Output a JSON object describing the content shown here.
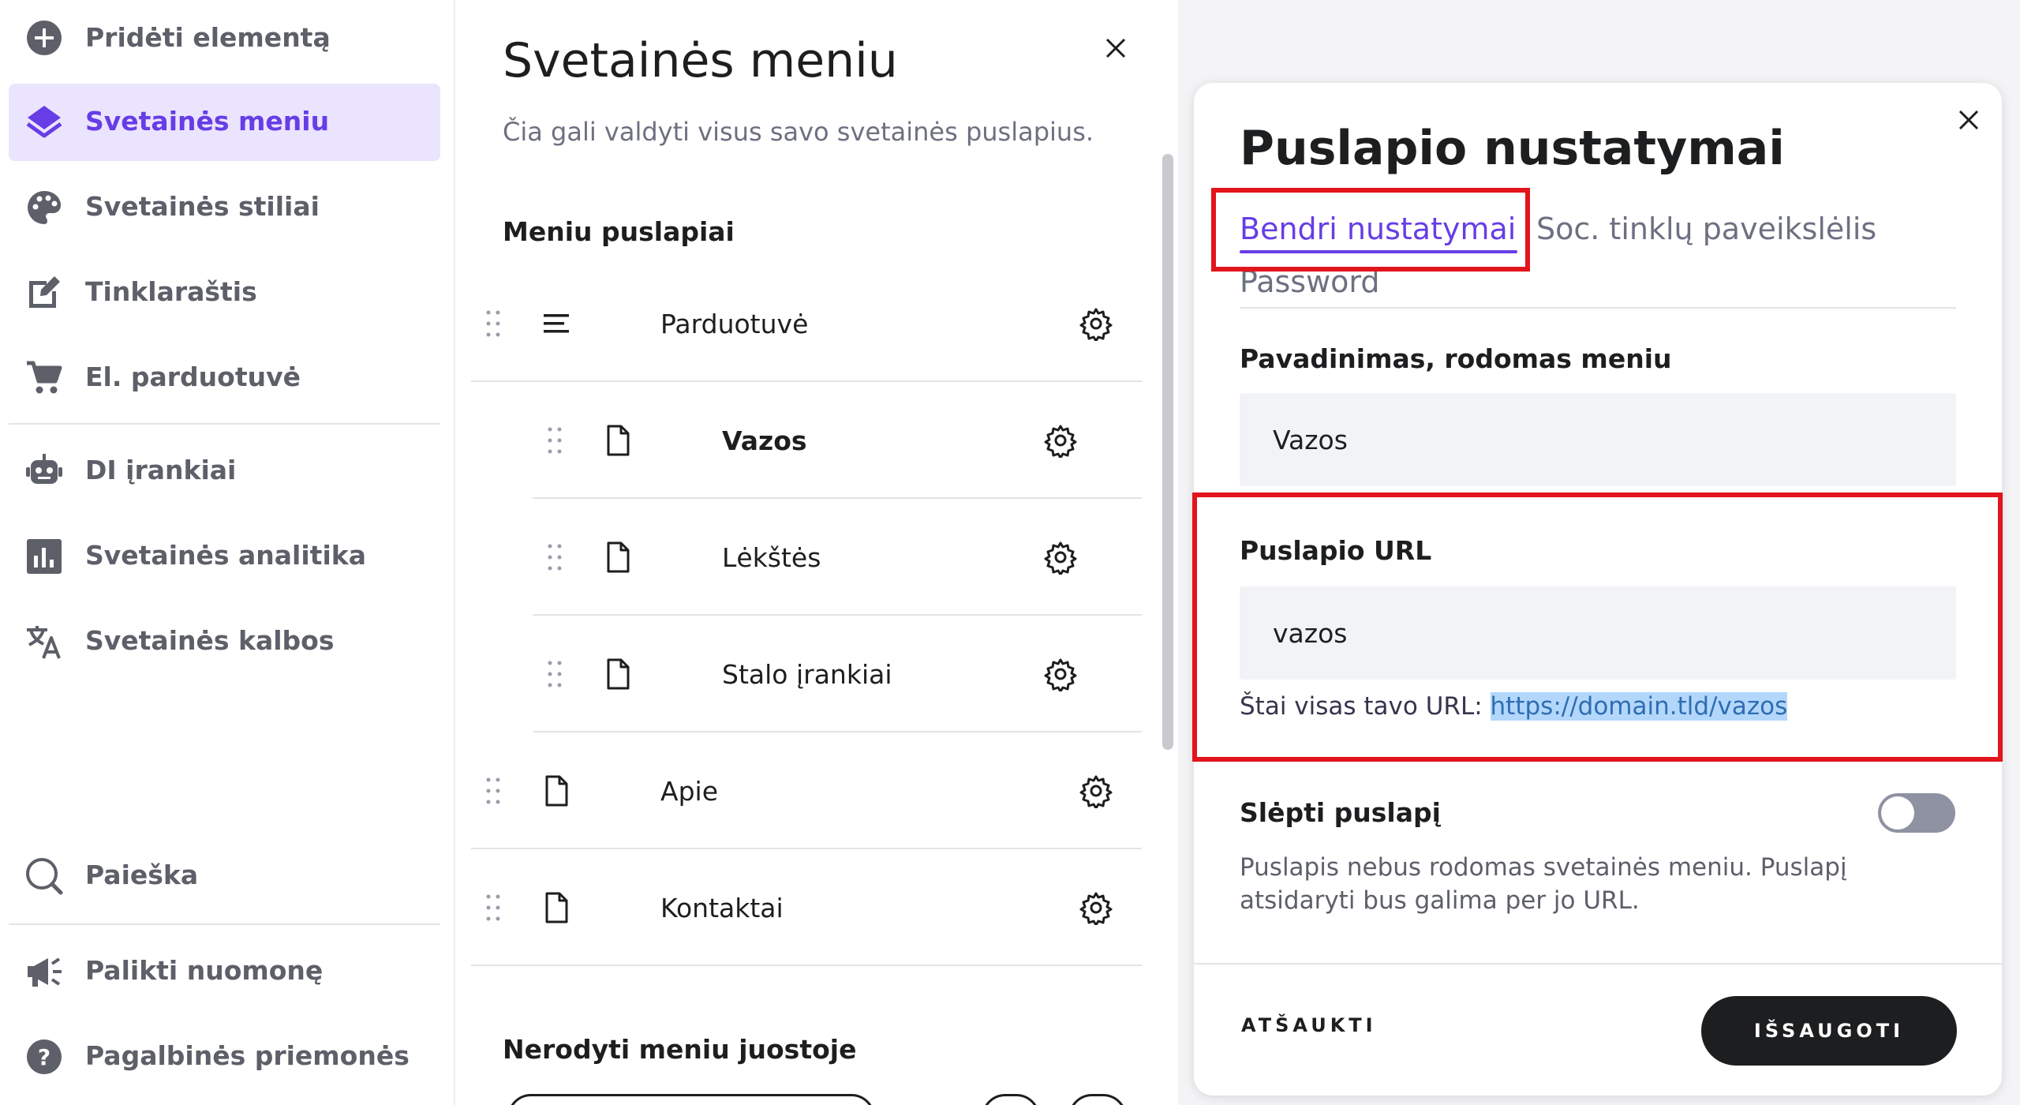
{
  "sidebar": {
    "items": [
      {
        "label": "Pridėti elementą",
        "icon": "plus-circle-icon",
        "active": false
      },
      {
        "label": "Svetainės meniu",
        "icon": "layers-icon",
        "active": true
      },
      {
        "label": "Svetainės stiliai",
        "icon": "palette-icon",
        "active": false
      },
      {
        "label": "Tinklaraštis",
        "icon": "edit-icon",
        "active": false
      },
      {
        "label": "El. parduotuvė",
        "icon": "cart-icon",
        "active": false
      },
      {
        "label": "DI įrankiai",
        "icon": "robot-icon",
        "active": false
      },
      {
        "label": "Svetainės analitika",
        "icon": "analytics-icon",
        "active": false
      },
      {
        "label": "Svetainės kalbos",
        "icon": "translate-icon",
        "active": false
      },
      {
        "label": "Paieška",
        "icon": "search-icon",
        "active": false
      },
      {
        "label": "Palikti nuomonę",
        "icon": "megaphone-icon",
        "active": false
      },
      {
        "label": "Pagalbinės priemonės",
        "icon": "help-icon",
        "active": false
      }
    ]
  },
  "menu_panel": {
    "title": "Svetainės meniu",
    "subtitle": "Čia gali valdyti visus savo svetainės puslapius.",
    "section_label": "Meniu puslapiai",
    "pages": [
      {
        "label": "Parduotuvė",
        "icon": "list-icon",
        "level": 0,
        "bold": false
      },
      {
        "label": "Vazos",
        "icon": "page-icon",
        "level": 1,
        "bold": true
      },
      {
        "label": "Lėkštės",
        "icon": "page-icon",
        "level": 1,
        "bold": false
      },
      {
        "label": "Stalo įrankiai",
        "icon": "page-icon",
        "level": 1,
        "bold": false
      },
      {
        "label": "Apie",
        "icon": "page-icon",
        "level": 0,
        "bold": false
      },
      {
        "label": "Kontaktai",
        "icon": "page-icon",
        "level": 0,
        "bold": false
      }
    ],
    "hidden_section_label": "Nerodyti meniu juostoje"
  },
  "dialog": {
    "title": "Puslapio nustatymai",
    "tabs": {
      "general": "Bendri nustatymai",
      "social": "Soc. tinklų paveikslėlis",
      "password": "Password"
    },
    "menu_name_label": "Pavadinimas, rodomas meniu",
    "menu_name_value": "Vazos",
    "url_label": "Puslapio URL",
    "url_value": "vazos",
    "url_hint_prefix": "Štai visas tavo URL: ",
    "url_hint_link": "https://domain.tld/vazos",
    "hide_label": "Slėpti puslapį",
    "hide_enabled": false,
    "hide_description": "Puslapis nebus rodomas svetainės meniu. Puslapį atsidaryti bus galima per jo URL.",
    "cancel_label": "ATŠAUKTI",
    "save_label": "IŠSAUGOTI"
  },
  "colors": {
    "accent": "#673de6",
    "active_bg": "#ebe4ff",
    "highlight": "#e2141c",
    "dark_button": "#1d1e20"
  }
}
